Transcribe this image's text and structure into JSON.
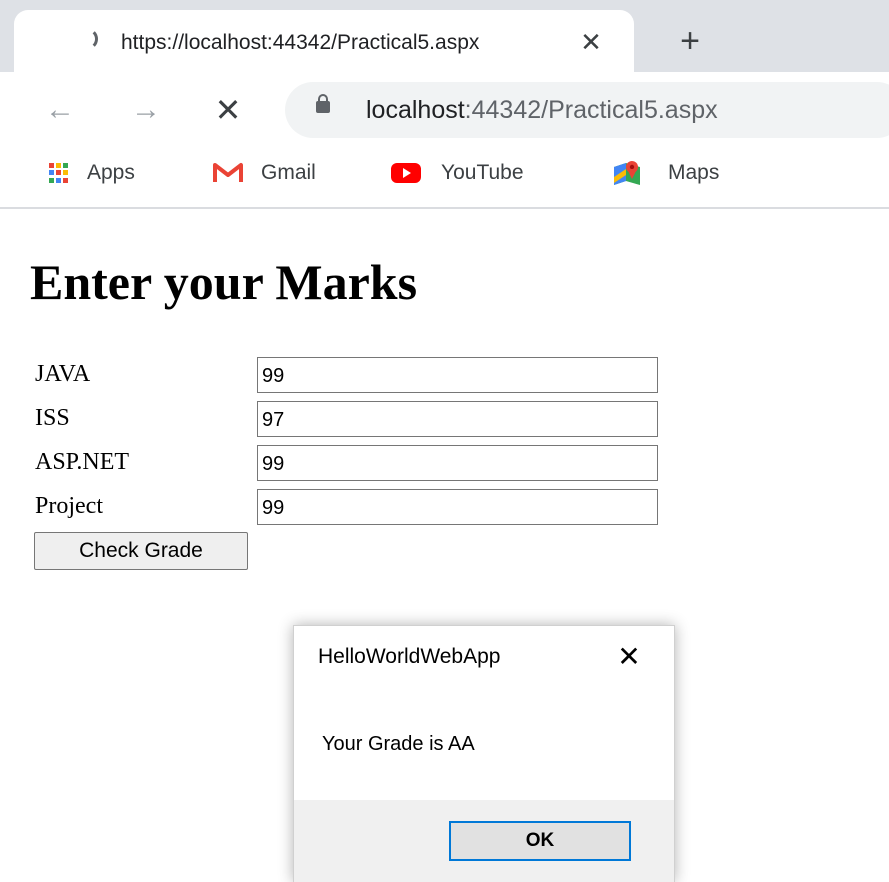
{
  "browser": {
    "tab": {
      "title": "https://localhost:44342/Practical5.aspx",
      "close": "✕"
    },
    "new_tab": "+",
    "nav": {
      "back": "←",
      "forward": "→",
      "stop": "✕"
    },
    "address": {
      "host": "localhost",
      "path": ":44342/Practical5.aspx"
    },
    "bookmarks": [
      {
        "label": "Apps",
        "icon": "apps-grid-icon"
      },
      {
        "label": "Gmail",
        "icon": "gmail-icon"
      },
      {
        "label": "YouTube",
        "icon": "youtube-icon"
      },
      {
        "label": "Maps",
        "icon": "maps-icon"
      }
    ]
  },
  "page": {
    "title": "Enter your Marks",
    "fields": [
      {
        "label": "JAVA",
        "value": "99"
      },
      {
        "label": "ISS",
        "value": "97"
      },
      {
        "label": "ASP.NET",
        "value": "99"
      },
      {
        "label": "Project",
        "value": "99"
      }
    ],
    "button": "Check Grade"
  },
  "dialog": {
    "title": "HelloWorldWebApp",
    "close": "✕",
    "message": "Your Grade is AA",
    "ok": "OK"
  },
  "colors": {
    "tab_strip": "#dee1e6",
    "omnibox": "#f1f3f4",
    "dialog_accent": "#0078d7",
    "gmail_red": "#ea4335",
    "youtube_red": "#ff0000"
  }
}
